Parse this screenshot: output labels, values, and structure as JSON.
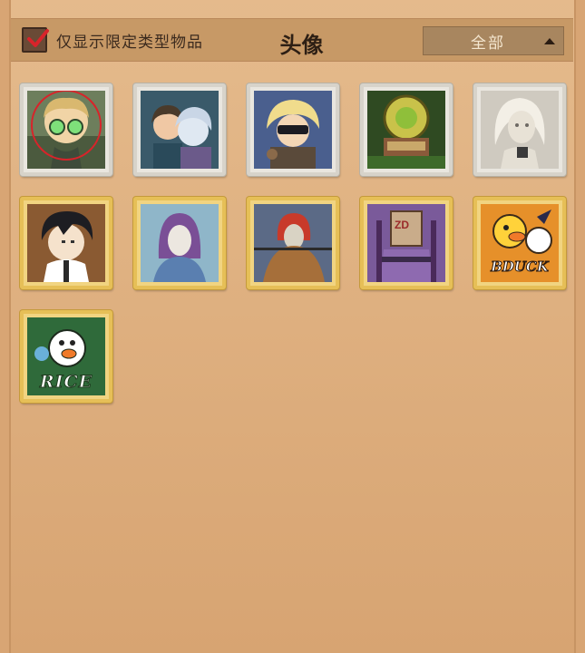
{
  "header": {
    "filter_label": "仅显示限定类型物品",
    "filter_checked": true,
    "title": "头像",
    "dropdown_value": "全部"
  },
  "avatars": [
    {
      "name": "avatar-green-glasses",
      "frame": "silver",
      "selected": true
    },
    {
      "name": "avatar-duo-teal",
      "frame": "silver"
    },
    {
      "name": "avatar-blonde-mask",
      "frame": "silver"
    },
    {
      "name": "avatar-green-mech",
      "frame": "silver"
    },
    {
      "name": "avatar-white-doll",
      "frame": "silver"
    },
    {
      "name": "avatar-black-hair-boy",
      "frame": "gold"
    },
    {
      "name": "avatar-purple-hooded",
      "frame": "gold"
    },
    {
      "name": "avatar-red-mask-cloak",
      "frame": "gold"
    },
    {
      "name": "avatar-box-head",
      "frame": "gold",
      "box_text": "ZD"
    },
    {
      "name": "avatar-bduck",
      "frame": "gold",
      "logo_text": "BDUCK"
    },
    {
      "name": "avatar-rice",
      "frame": "gold",
      "logo_text": "RICE"
    }
  ],
  "colors": {
    "background": "#dcaa78",
    "header_bar": "#c79966",
    "gold_frame": "#e6bf57",
    "silver_frame": "#d7d3ca",
    "selection_ring": "#d9232a"
  }
}
